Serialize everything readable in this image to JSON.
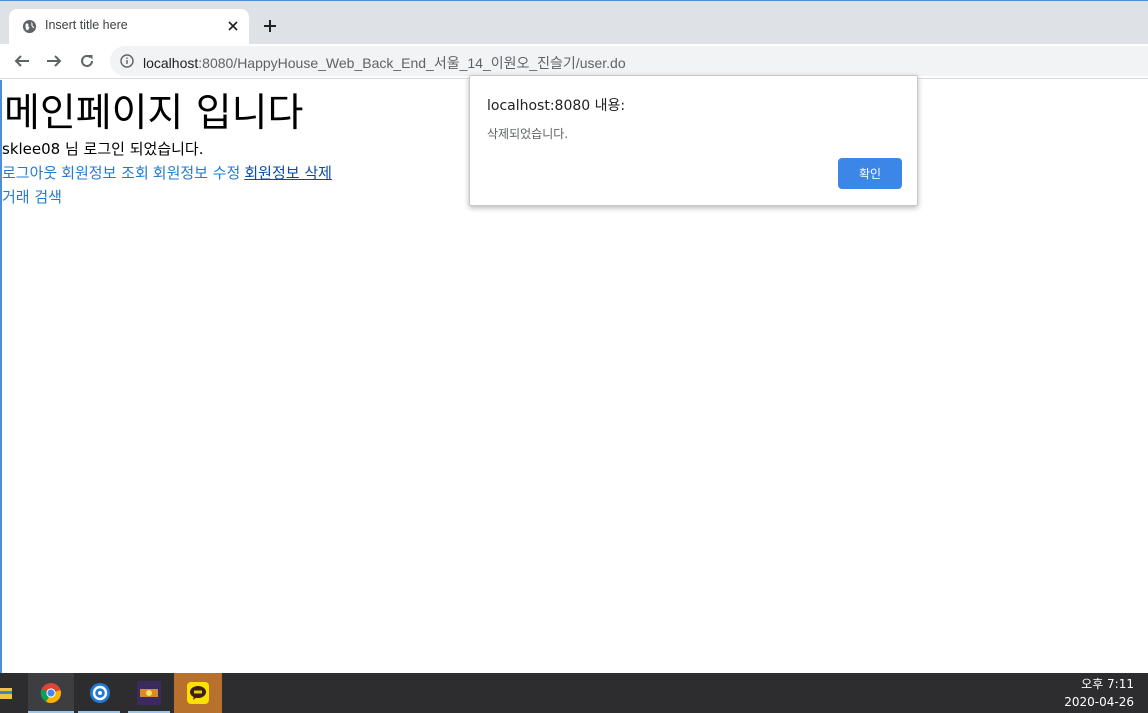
{
  "browser": {
    "tab_title": "Insert title here",
    "url_host": "localhost",
    "url_rest": ":8080/HappyHouse_Web_Back_End_서울_14_이원오_진슬기/user.do"
  },
  "page": {
    "heading": "메인페이지 입니다",
    "welcome": "sklee08 님 로그인 되었습니다.",
    "links": {
      "logout": "로그아웃",
      "view_info": "회원정보 조회",
      "edit_info": "회원정보 수정",
      "delete_info": "회원정보 삭제",
      "search_deals": "거래 검색"
    }
  },
  "dialog": {
    "title": "localhost:8080 내용:",
    "message": "삭제되었습니다.",
    "ok_label": "확인"
  },
  "taskbar": {
    "time": "오후 7:11",
    "date": "2020-04-26",
    "apps": [
      "file-explorer-icon",
      "chrome-icon",
      "app-blue-circle-icon",
      "app-game-icon",
      "kakaotalk-icon"
    ]
  },
  "colors": {
    "link": "#1e7cd6",
    "link_visited": "#0c4aa3",
    "dialog_button": "#3b86e6",
    "taskbar": "#2d2d30"
  }
}
